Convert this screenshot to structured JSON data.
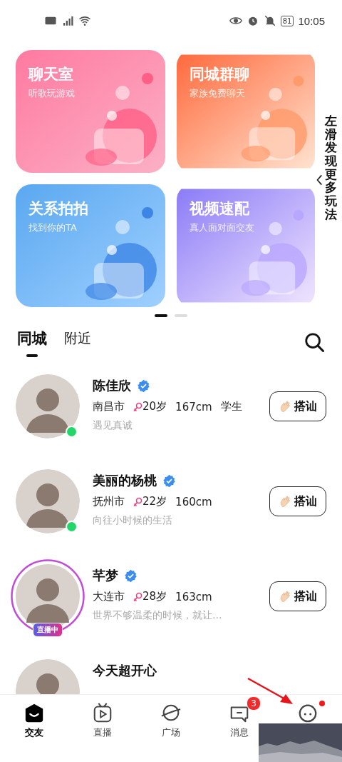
{
  "status_bar": {
    "time": "10:05",
    "battery": "81"
  },
  "cards": [
    {
      "title": "聊天室",
      "subtitle": "听歌玩游戏",
      "kind": "pink"
    },
    {
      "title": "同城群聊",
      "subtitle": "家族免费聊天",
      "kind": "orange"
    },
    {
      "title": "关系拍拍",
      "subtitle": "找到你的TA",
      "kind": "blue"
    },
    {
      "title": "视频速配",
      "subtitle": "真人面对面交友",
      "kind": "purple"
    }
  ],
  "side_hint": "左滑发现更多玩法",
  "pager": [
    {
      "selected": true
    },
    {
      "selected": false
    }
  ],
  "tabs": [
    {
      "label": "同城",
      "selected": true
    },
    {
      "label": "附近",
      "selected": false
    }
  ],
  "users": [
    {
      "name": "陈佳欣",
      "verified": true,
      "city": "南昌市",
      "age": "20岁",
      "height": "167cm",
      "job": "学生",
      "bio": "遇见真诚",
      "online": true,
      "button": "搭讪"
    },
    {
      "name": "美丽的杨桃",
      "verified": true,
      "city": "抚州市",
      "age": "22岁",
      "height": "160cm",
      "bio": "向往小时候的生活",
      "online": true,
      "button": "搭讪"
    },
    {
      "name": "芊梦",
      "verified": true,
      "city": "大连市",
      "age": "28岁",
      "height": "163cm",
      "bio": "世界不够温柔的时候，就让...",
      "live": true,
      "live_label": "直播中",
      "button": "搭讪"
    },
    {
      "name": "今天超开心"
    }
  ],
  "nav": [
    {
      "label": "交友",
      "selected": true
    },
    {
      "label": "直播",
      "selected": false
    },
    {
      "label": "广场",
      "selected": false
    },
    {
      "label": "消息",
      "selected": false,
      "badge": "3"
    },
    {
      "selected": false,
      "dot": true
    }
  ]
}
